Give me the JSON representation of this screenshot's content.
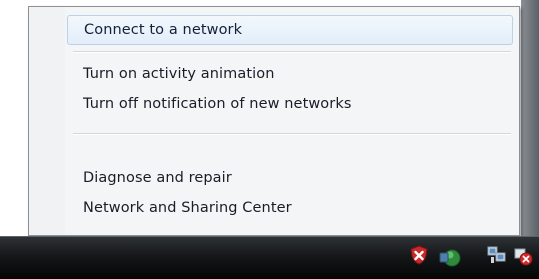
{
  "context_menu": {
    "items": [
      {
        "label": "Connect to a network",
        "highlighted": true
      },
      {
        "label": "Turn on activity animation"
      },
      {
        "label": "Turn off notification of new networks"
      },
      {
        "label": "Diagnose and repair"
      },
      {
        "label": "Network and Sharing Center"
      }
    ],
    "highlight_color": "#e3eef9",
    "background_color": "#f4f5f6"
  },
  "taskbar": {
    "tray_icons": [
      "security-shield-icon",
      "network-status-icon",
      "network-icon",
      "network-error-icon"
    ],
    "background_color": "#151719"
  }
}
